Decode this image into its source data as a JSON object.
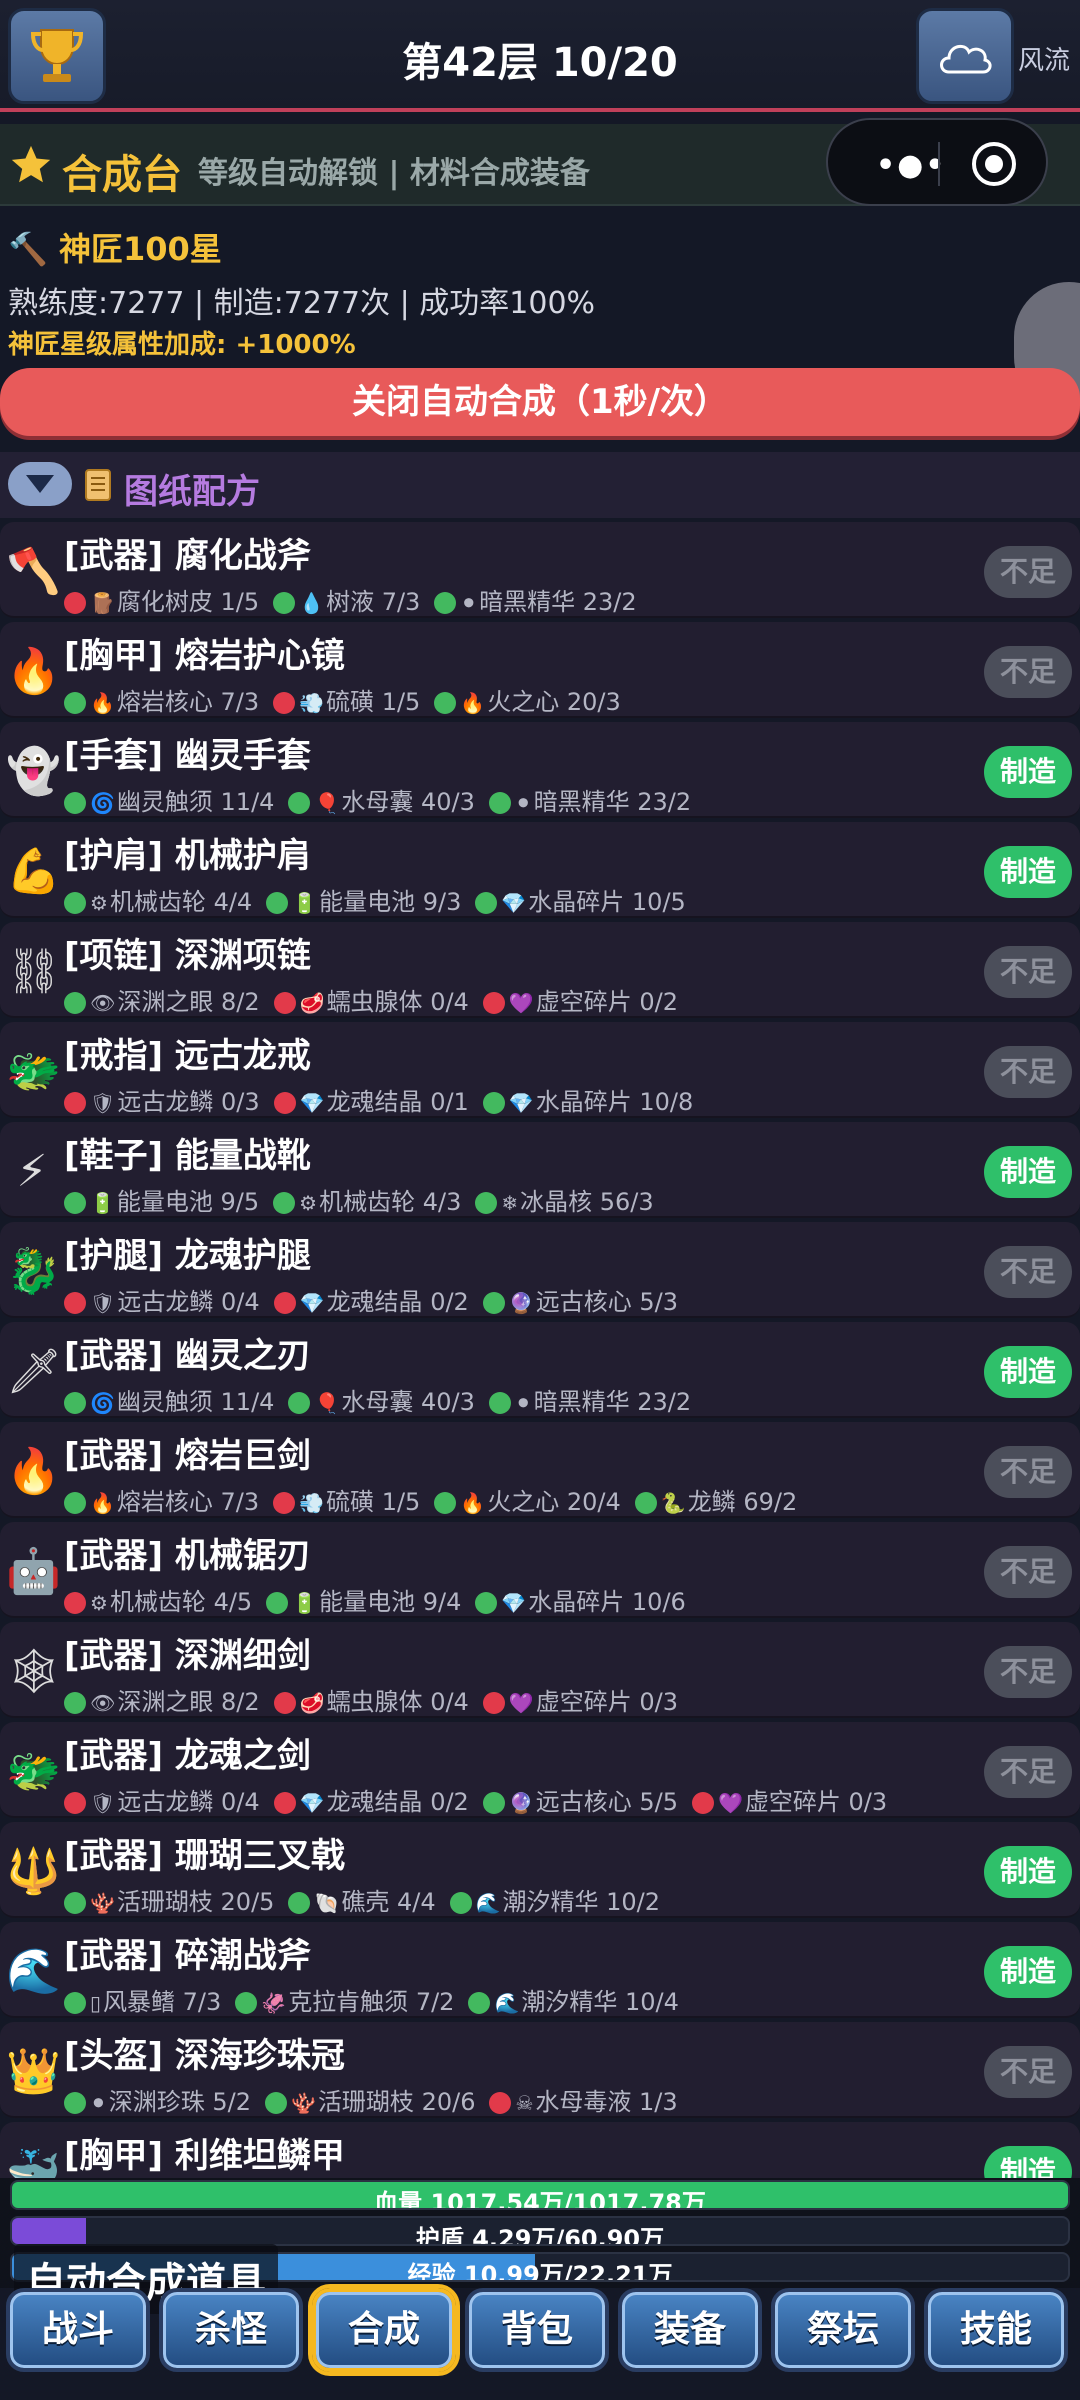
{
  "header": {
    "title": "第42层 10/20",
    "user_label": "风流"
  },
  "forge": {
    "title": "合成台",
    "subtitle": "等级自动解锁 | 材料合成装备"
  },
  "stats": {
    "rank": "神匠100星",
    "line": "熟练度:7277 | 制造:7277次 | 成功率100%",
    "bonus": "神匠星级属性加成: +1000%"
  },
  "auto_button": "关闭自动合成（1秒/次）",
  "recipes_title": "图纸配方",
  "recipes": [
    {
      "icon": "axe-icon",
      "glyph": "🪓",
      "name": "[武器] 腐化战斧",
      "button": "不足",
      "can_make": false,
      "mats": [
        {
          "ok": false,
          "icon": "🪵",
          "text": "腐化树皮 1/5"
        },
        {
          "ok": true,
          "icon": "💧",
          "text": "树液 7/3"
        },
        {
          "ok": true,
          "icon": "⚫",
          "text": "暗黑精华 23/2"
        }
      ]
    },
    {
      "icon": "fire-icon",
      "glyph": "🔥",
      "name": "[胸甲] 熔岩护心镜",
      "button": "不足",
      "can_make": false,
      "mats": [
        {
          "ok": true,
          "icon": "🔥",
          "text": "熔岩核心 7/3"
        },
        {
          "ok": false,
          "icon": "💨",
          "text": "硫磺 1/5"
        },
        {
          "ok": true,
          "icon": "🔥",
          "text": "火之心 20/3"
        }
      ]
    },
    {
      "icon": "ghost-icon",
      "glyph": "👻",
      "name": "[手套] 幽灵手套",
      "button": "制造",
      "can_make": true,
      "mats": [
        {
          "ok": true,
          "icon": "🌀",
          "text": "幽灵触须 11/4"
        },
        {
          "ok": true,
          "icon": "🎈",
          "text": "水母囊 40/3"
        },
        {
          "ok": true,
          "icon": "⚫",
          "text": "暗黑精华 23/2"
        }
      ]
    },
    {
      "icon": "arm-icon",
      "glyph": "💪",
      "name": "[护肩] 机械护肩",
      "button": "制造",
      "can_make": true,
      "mats": [
        {
          "ok": true,
          "icon": "⚙",
          "text": "机械齿轮 4/4"
        },
        {
          "ok": true,
          "icon": "🔋",
          "text": "能量电池 9/3"
        },
        {
          "ok": true,
          "icon": "💎",
          "text": "水晶碎片 10/5"
        }
      ]
    },
    {
      "icon": "chain-icon",
      "glyph": "⛓",
      "name": "[项链] 深渊项链",
      "button": "不足",
      "can_make": false,
      "mats": [
        {
          "ok": true,
          "icon": "👁",
          "text": "深渊之眼 8/2"
        },
        {
          "ok": false,
          "icon": "🥩",
          "text": "蠕虫腺体 0/4"
        },
        {
          "ok": false,
          "icon": "💜",
          "text": "虚空碎片 0/2"
        }
      ]
    },
    {
      "icon": "dragon-icon",
      "glyph": "🐲",
      "name": "[戒指] 远古龙戒",
      "button": "不足",
      "can_make": false,
      "mats": [
        {
          "ok": false,
          "icon": "🛡",
          "text": "远古龙鳞 0/3"
        },
        {
          "ok": false,
          "icon": "💎",
          "text": "龙魂结晶 0/1"
        },
        {
          "ok": true,
          "icon": "💎",
          "text": "水晶碎片 10/8"
        }
      ]
    },
    {
      "icon": "lightning-icon",
      "glyph": "⚡",
      "name": "[鞋子] 能量战靴",
      "button": "制造",
      "can_make": true,
      "mats": [
        {
          "ok": true,
          "icon": "🔋",
          "text": "能量电池 9/5"
        },
        {
          "ok": true,
          "icon": "⚙",
          "text": "机械齿轮 4/3"
        },
        {
          "ok": true,
          "icon": "❄",
          "text": "冰晶核 56/3"
        }
      ]
    },
    {
      "icon": "dragon-icon",
      "glyph": "🐉",
      "name": "[护腿] 龙魂护腿",
      "button": "不足",
      "can_make": false,
      "mats": [
        {
          "ok": false,
          "icon": "🛡",
          "text": "远古龙鳞 0/4"
        },
        {
          "ok": false,
          "icon": "💎",
          "text": "龙魂结晶 0/2"
        },
        {
          "ok": true,
          "icon": "🔮",
          "text": "远古核心 5/3"
        }
      ]
    },
    {
      "icon": "dagger-icon",
      "glyph": "🗡",
      "name": "[武器] 幽灵之刃",
      "button": "制造",
      "can_make": true,
      "mats": [
        {
          "ok": true,
          "icon": "🌀",
          "text": "幽灵触须 11/4"
        },
        {
          "ok": true,
          "icon": "🎈",
          "text": "水母囊 40/3"
        },
        {
          "ok": true,
          "icon": "⚫",
          "text": "暗黑精华 23/2"
        }
      ]
    },
    {
      "icon": "fire-icon",
      "glyph": "🔥",
      "name": "[武器] 熔岩巨剑",
      "button": "不足",
      "can_make": false,
      "mats": [
        {
          "ok": true,
          "icon": "🔥",
          "text": "熔岩核心 7/3"
        },
        {
          "ok": false,
          "icon": "💨",
          "text": "硫磺 1/5"
        },
        {
          "ok": true,
          "icon": "🔥",
          "text": "火之心 20/4"
        },
        {
          "ok": true,
          "icon": "🐍",
          "text": "龙鳞 69/2"
        }
      ]
    },
    {
      "icon": "robot-icon",
      "glyph": "🤖",
      "name": "[武器] 机械锯刃",
      "button": "不足",
      "can_make": false,
      "mats": [
        {
          "ok": false,
          "icon": "⚙",
          "text": "机械齿轮 4/5"
        },
        {
          "ok": true,
          "icon": "🔋",
          "text": "能量电池 9/4"
        },
        {
          "ok": true,
          "icon": "💎",
          "text": "水晶碎片 10/6"
        }
      ]
    },
    {
      "icon": "web-icon",
      "glyph": "🕸",
      "name": "[武器] 深渊细剑",
      "button": "不足",
      "can_make": false,
      "mats": [
        {
          "ok": true,
          "icon": "👁",
          "text": "深渊之眼 8/2"
        },
        {
          "ok": false,
          "icon": "🥩",
          "text": "蠕虫腺体 0/4"
        },
        {
          "ok": false,
          "icon": "💜",
          "text": "虚空碎片 0/3"
        }
      ]
    },
    {
      "icon": "dragon-icon",
      "glyph": "🐲",
      "name": "[武器] 龙魂之剑",
      "button": "不足",
      "can_make": false,
      "mats": [
        {
          "ok": false,
          "icon": "🛡",
          "text": "远古龙鳞 0/4"
        },
        {
          "ok": false,
          "icon": "💎",
          "text": "龙魂结晶 0/2"
        },
        {
          "ok": true,
          "icon": "🔮",
          "text": "远古核心 5/5"
        },
        {
          "ok": false,
          "icon": "💜",
          "text": "虚空碎片 0/3"
        }
      ]
    },
    {
      "icon": "trident-icon",
      "glyph": "🔱",
      "name": "[武器] 珊瑚三叉戟",
      "button": "制造",
      "can_make": true,
      "mats": [
        {
          "ok": true,
          "icon": "🪸",
          "text": "活珊瑚枝 20/5"
        },
        {
          "ok": true,
          "icon": "🐚",
          "text": "礁壳 4/4"
        },
        {
          "ok": true,
          "icon": "🌊",
          "text": "潮汐精华 10/2"
        }
      ]
    },
    {
      "icon": "wave-icon",
      "glyph": "🌊",
      "name": "[武器] 碎潮战斧",
      "button": "制造",
      "can_make": true,
      "mats": [
        {
          "ok": true,
          "icon": "▯",
          "text": "风暴鳍 7/3"
        },
        {
          "ok": true,
          "icon": "🦑",
          "text": "克拉肯触须 7/2"
        },
        {
          "ok": true,
          "icon": "🌊",
          "text": "潮汐精华 10/4"
        }
      ]
    },
    {
      "icon": "crown-icon",
      "glyph": "👑",
      "name": "[头盔] 深海珍珠冠",
      "button": "不足",
      "can_make": false,
      "mats": [
        {
          "ok": true,
          "icon": "⚫",
          "text": "深渊珍珠 5/2"
        },
        {
          "ok": true,
          "icon": "🪸",
          "text": "活珊瑚枝 20/6"
        },
        {
          "ok": false,
          "icon": "☠",
          "text": "水母毒液 1/3"
        }
      ]
    },
    {
      "icon": "whale-icon",
      "glyph": "🐳",
      "name": "[胸甲] 利维坦鳞甲",
      "button": "制造",
      "can_make": true,
      "mats": []
    }
  ],
  "bars": {
    "hp": {
      "label": "血量 1017.54万/1017.78万",
      "fraction": 0.9998,
      "color": "#2fc06a"
    },
    "shield": {
      "label": "护盾 4.29万/60.90万",
      "fraction": 0.0704,
      "color": "#7b4bd8"
    },
    "exp": {
      "label": "经验 10.99万/22.21万",
      "fraction": 0.4948,
      "color": "#3b8fdc"
    }
  },
  "hint": "自动合成道具",
  "nav": [
    {
      "label": "战斗",
      "active": false
    },
    {
      "label": "杀怪",
      "active": false
    },
    {
      "label": "合成",
      "active": true
    },
    {
      "label": "背包",
      "active": false
    },
    {
      "label": "装备",
      "active": false
    },
    {
      "label": "祭坛",
      "active": false
    },
    {
      "label": "技能",
      "active": false
    }
  ]
}
